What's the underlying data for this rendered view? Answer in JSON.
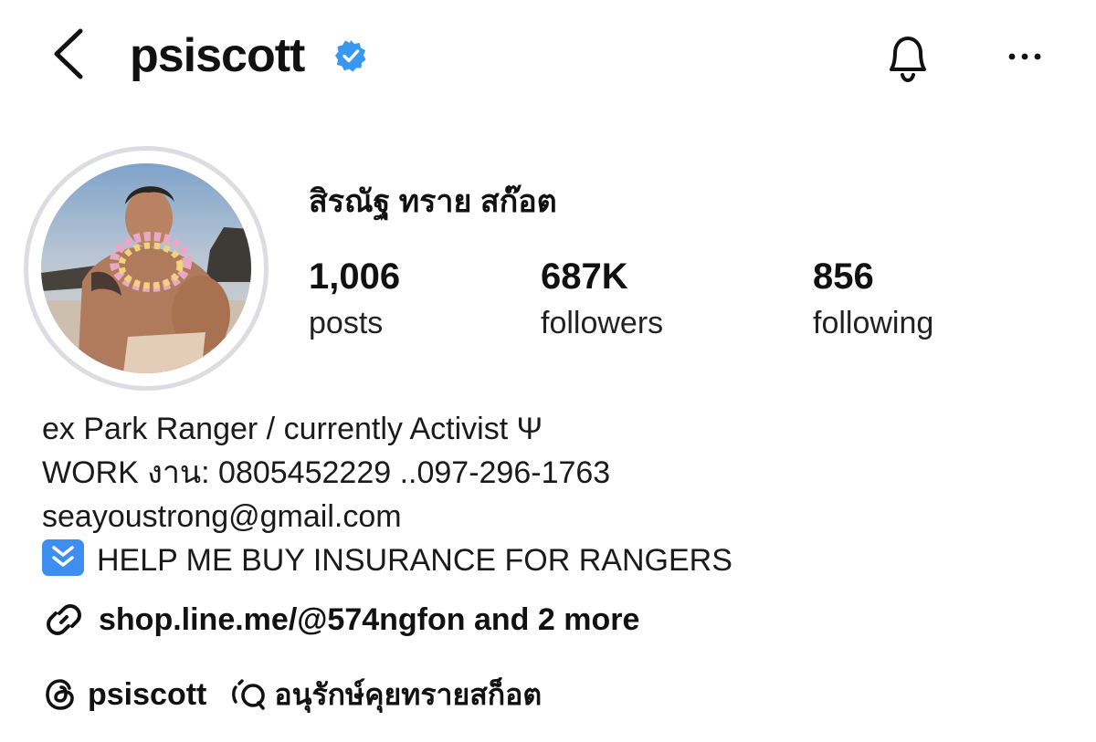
{
  "header": {
    "username": "psiscott",
    "verified_color": "#3897f0"
  },
  "profile": {
    "full_name": "สิรณัฐ ทราย สก๊อต",
    "stats": [
      {
        "count": "1,006",
        "label": "posts"
      },
      {
        "count": "687K",
        "label": "followers"
      },
      {
        "count": "856",
        "label": "following"
      }
    ]
  },
  "bio": {
    "line1": "ex Park Ranger / currently Activist Ψ",
    "line2": "WORK งาน: 0805452229 ..097-296-1763",
    "line3": "seayoustrong@gmail.com",
    "line4": "HELP ME BUY INSURANCE FOR RANGERS",
    "line4_emoji": "down-arrow-emoji"
  },
  "link": {
    "text": "shop.line.me/@574ngfon and 2 more",
    "icon": "link-icon"
  },
  "threads": {
    "handle": "psiscott",
    "icon": "threads-icon"
  },
  "note": {
    "text": "อนุรักษ์คุยทรายสก็อต",
    "icon": "note-bubble-icon"
  },
  "icons": {
    "back": "chevron-left-icon",
    "verified": "verified-badge-icon",
    "notifications": "bell-icon",
    "more": "more-dots-icon"
  }
}
